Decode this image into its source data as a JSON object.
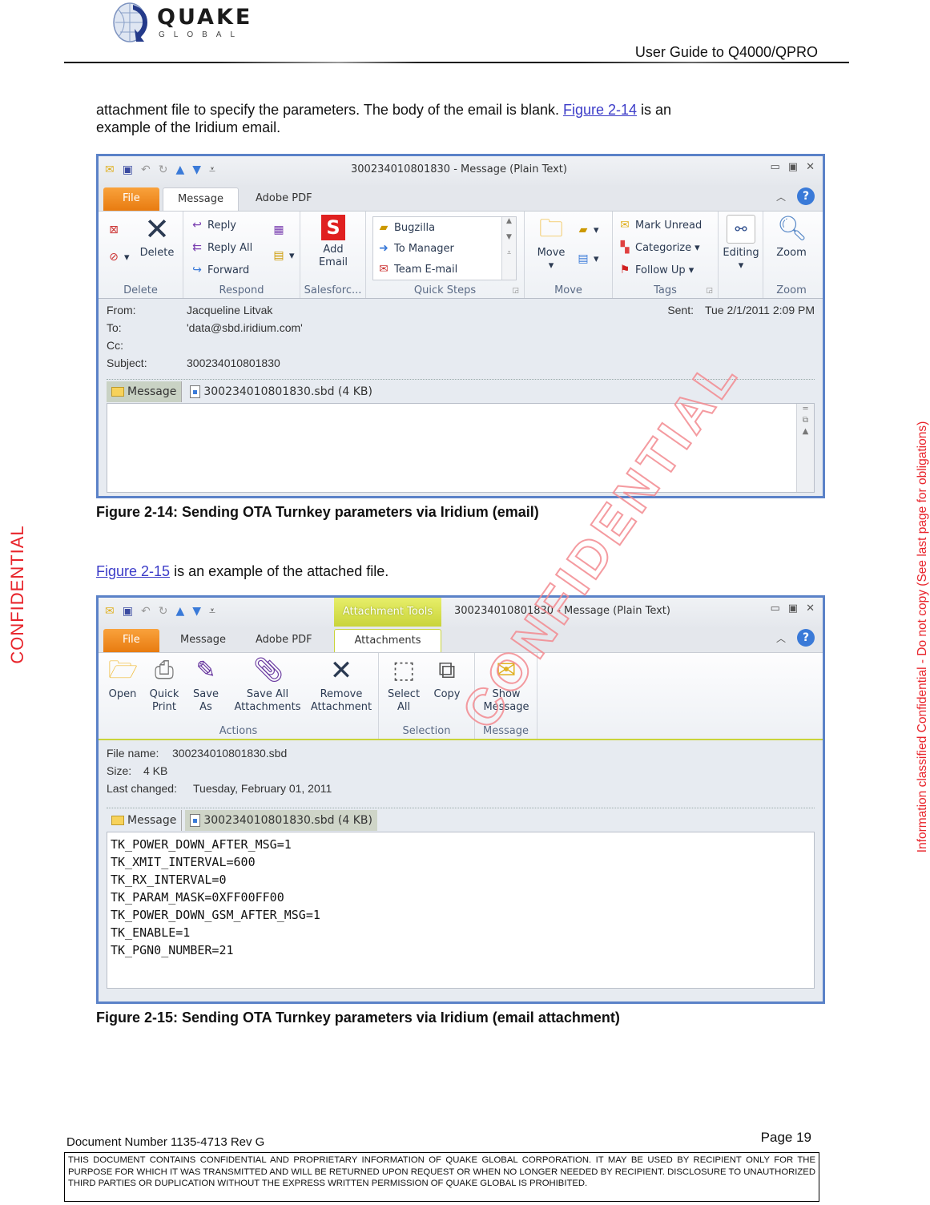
{
  "header": {
    "logo_brand": "QUAKE",
    "logo_sub": "GLOBAL",
    "guide_title": "User Guide to Q4000/QPRO"
  },
  "intro": {
    "line_before_link": "attachment file to specify the parameters.  The body of the email is blank.  ",
    "link": "Figure 2-14",
    "line_after_link": " is an",
    "line2": "example of the Iridium email."
  },
  "figure14": {
    "caption": "Figure 2-14:  Sending OTA Turnkey parameters via Iridium (email)",
    "window_title": "300234010801830  -  Message (Plain Text)",
    "tabs": [
      "File",
      "Message",
      "Adobe PDF"
    ],
    "active_tab": "Message",
    "ribbon": {
      "delete_group": {
        "label": "Delete",
        "delete_button": "Delete"
      },
      "respond_group": {
        "label": "Respond",
        "reply": "Reply",
        "reply_all": "Reply All",
        "forward": "Forward"
      },
      "salesforce_group": {
        "label": "Salesforc...",
        "add_email": "Add Email"
      },
      "quick_steps_group": {
        "label": "Quick Steps",
        "items": [
          "Bugzilla",
          "To Manager",
          "Team E-mail"
        ]
      },
      "move_group": {
        "label": "Move",
        "move_button": "Move"
      },
      "tags_group": {
        "label": "Tags",
        "mark_unread": "Mark Unread",
        "categorize": "Categorize",
        "follow_up": "Follow Up"
      },
      "editing_group": {
        "editing_button": "Editing"
      },
      "zoom_group": {
        "label": "Zoom",
        "zoom_button": "Zoom"
      }
    },
    "message_header": {
      "from_label": "From:",
      "from": "Jacqueline Litvak",
      "to_label": "To:",
      "to": "'data@sbd.iridium.com'",
      "cc_label": "Cc:",
      "cc": "",
      "subject_label": "Subject:",
      "subject": "300234010801830",
      "sent_label": "Sent:",
      "sent": "Tue 2/1/2011 2:09 PM"
    },
    "attachments_bar": {
      "message_button": "Message",
      "attachment": "300234010801830.sbd (4 KB)"
    }
  },
  "middle": {
    "link": "Figure 2-15",
    "text": " is an  example of the attached file."
  },
  "figure15": {
    "caption": "Figure 2-15:  Sending OTA Turnkey parameters via Iridium (email attachment)",
    "window_title": "300234010801830  -  Message (Plain Text)",
    "context_tab": "Attachment Tools",
    "tabs": [
      "File",
      "Message",
      "Adobe PDF",
      "Attachments"
    ],
    "active_tab": "Attachments",
    "ribbon": {
      "actions_group": {
        "label": "Actions",
        "open": "Open",
        "quick_print": "Quick Print",
        "save_as": "Save As",
        "save_all": "Save All Attachments",
        "remove": "Remove Attachment"
      },
      "selection_group": {
        "label": "Selection",
        "select_all": "Select All",
        "copy": "Copy"
      },
      "message_group": {
        "label": "Message",
        "show_message": "Show Message"
      }
    },
    "file_info": {
      "file_name_label": "File name:",
      "file_name": "300234010801830.sbd",
      "size_label": "Size:",
      "size": "4 KB",
      "last_changed_label": "Last changed:",
      "last_changed": "Tuesday, February 01, 2011"
    },
    "attachments_bar": {
      "message_button": "Message",
      "attachment": "300234010801830.sbd (4 KB)"
    },
    "file_lines": [
      "TK_POWER_DOWN_AFTER_MSG=1",
      "TK_XMIT_INTERVAL=600",
      "TK_RX_INTERVAL=0",
      "TK_PARAM_MASK=0XFF00FF00",
      "TK_POWER_DOWN_GSM_AFTER_MSG=1",
      "TK_ENABLE=1",
      "TK_PGN0_NUMBER=21"
    ]
  },
  "footer": {
    "doc_number": "Document Number 1135-4713   Rev G",
    "page": "Page 19",
    "legal": "THIS DOCUMENT CONTAINS CONFIDENTIAL AND PROPRIETARY INFORMATION OF QUAKE GLOBAL CORPORATION.  IT MAY BE USED BY RECIPIENT ONLY FOR THE PURPOSE FOR WHICH IT WAS TRANSMITTED AND WILL BE RETURNED UPON REQUEST OR WHEN NO LONGER NEEDED BY RECIPIENT.  DISCLOSURE TO UNAUTHORIZED THIRD PARTIES OR DUPLICATION WITHOUT THE EXPRESS WRITTEN PERMISSION OF QUAKE GLOBAL IS PROHIBITED."
  },
  "margins": {
    "right_notice": "Information classified Confidential - Do not copy (See last page for obligations)",
    "left_notice": "CONFIDENTIAL",
    "watermark": "CONFIDENTIAL"
  },
  "colors": {
    "link": "#3c3cc8",
    "confidential_red": "#e8242b",
    "window_border": "#5b82c8",
    "file_tab": "#f28c1e",
    "attachment_tools": "#d6e04a"
  }
}
